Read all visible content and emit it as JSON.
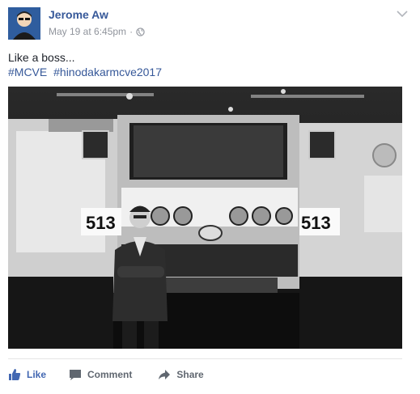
{
  "post": {
    "author": "Jerome Aw",
    "timestamp": "May 19 at 6:45pm",
    "separator": "·",
    "privacy_icon": "globe-icon",
    "menu_icon": "chevron-down-icon",
    "text": "Like a boss...",
    "hashtags": [
      "#MCVE",
      "#hinodakarmcve2017"
    ]
  },
  "photo": {
    "description_icon": "photo",
    "plate_number": "513"
  },
  "actions": {
    "like_label": "Like",
    "comment_label": "Comment",
    "share_label": "Share"
  },
  "colors": {
    "link": "#365899",
    "like": "#4267b2",
    "muted": "#90949c",
    "action": "#606770"
  }
}
